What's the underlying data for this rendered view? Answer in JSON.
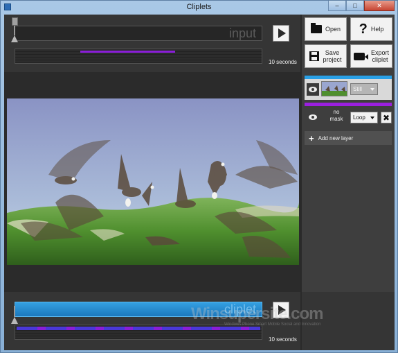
{
  "window": {
    "title": "Cliplets",
    "minimize": "–",
    "maximize": "□",
    "close": "✕"
  },
  "input_timeline": {
    "label": "input",
    "duration_label": "10 seconds"
  },
  "output_timeline": {
    "label": "cliplet",
    "duration_label": "10 seconds"
  },
  "toolbar": {
    "open_label": "Open",
    "help_label": "Help",
    "save_label": "Save\nproject",
    "export_label": "Export\ncliplet"
  },
  "layers": [
    {
      "mode": "Still",
      "accent": "#29a0e6"
    },
    {
      "mask_label": "no\nmask",
      "mode": "Loop",
      "accent": "#9b1fe0",
      "delete": "✖"
    }
  ],
  "add_layer_label": "Add new layer",
  "watermark": {
    "text": "Winsupersite.com",
    "subtitle": "Windows Phone Smart Mobile Social and Innovation"
  },
  "colors": {
    "accent_blue": "#29a0e6",
    "accent_purple": "#9b1fe0",
    "panel_bg": "#3e3e3e"
  }
}
